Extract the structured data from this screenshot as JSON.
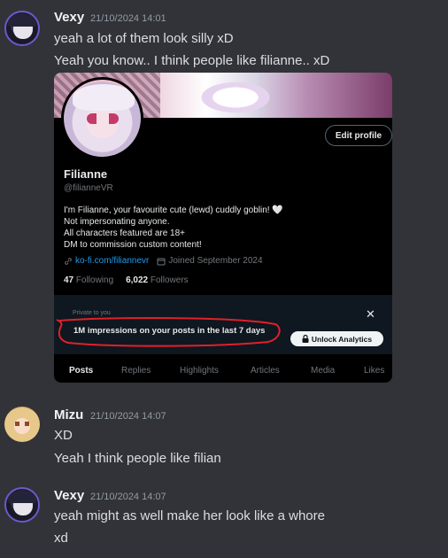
{
  "messages": [
    {
      "username": "Vexy",
      "timestamp": "21/10/2024 14:01",
      "lines": [
        "yeah a lot of them look silly xD",
        "Yeah you know.. I think people like filianne.. xD"
      ]
    },
    {
      "username": "Mizu",
      "timestamp": "21/10/2024 14:07",
      "lines": [
        "XD",
        "Yeah I think people like filian"
      ]
    },
    {
      "username": "Vexy",
      "timestamp": "21/10/2024 14:07",
      "lines": [
        "yeah might as well make her look like a whore",
        "xd"
      ]
    }
  ],
  "embed": {
    "edit_profile": "Edit profile",
    "name": "Filianne",
    "handle": "@filianneVR",
    "bio": [
      "I'm Filianne, your favourite cute (lewd) cuddly goblin!",
      "Not impersonating anyone.",
      "All characters featured are 18+",
      "DM to commission custom content!"
    ],
    "heart": "🤍",
    "link": "ko-fi.com/filiannevr",
    "joined": "Joined September 2024",
    "following_count": "47",
    "following_label": "Following",
    "followers_count": "6,022",
    "followers_label": "Followers",
    "private_label": "Private to you",
    "impressions": "1M impressions on your posts in the last 7 days",
    "close": "✕",
    "unlock": "Unlock Analytics",
    "tabs": [
      "Posts",
      "Replies",
      "Highlights",
      "Articles",
      "Media",
      "Likes"
    ],
    "annotation_color": "#e0202a"
  }
}
